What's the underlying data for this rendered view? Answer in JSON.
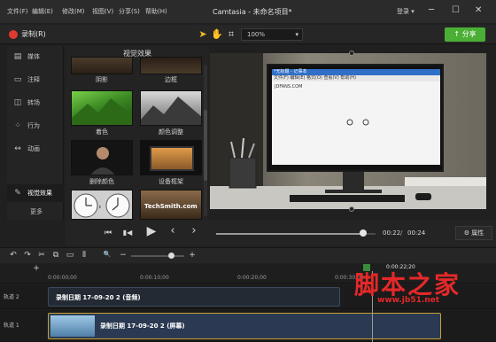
{
  "menubar": {
    "items": [
      "文件(F)",
      "编辑(E)",
      "修改(M)",
      "视图(V)",
      "分享(S)",
      "帮助(H)"
    ],
    "title": "Camtasia - 未命名项目*",
    "login": "登录",
    "login_caret": "▾",
    "minimize": "─",
    "maximize": "☐",
    "close": "✕"
  },
  "toolbar": {
    "record_label": "录制(R)",
    "zoom_value": "100%",
    "zoom_caret": "▾",
    "share_label": "分享",
    "share_icon": "↑"
  },
  "sidebar": {
    "items": [
      {
        "label": "媒体",
        "icon": "▤"
      },
      {
        "label": "注释",
        "icon": "▭"
      },
      {
        "label": "转场",
        "icon": "◫"
      },
      {
        "label": "行为",
        "icon": "⁘"
      },
      {
        "label": "动画",
        "icon": "↔"
      },
      {
        "label": "视觉效果",
        "icon": "✎"
      }
    ],
    "more": "更多",
    "active_index": 5
  },
  "effects": {
    "title": "视觉效果",
    "thumbs": [
      {
        "label": "阴影"
      },
      {
        "label": "边框"
      },
      {
        "label": "着色"
      },
      {
        "label": "颜色调整"
      },
      {
        "label": "删除颜色"
      },
      {
        "label": "设备框架"
      },
      {
        "label": ""
      },
      {
        "label": "TechSmith.com"
      }
    ]
  },
  "playback": {
    "prev_icon": "⏮",
    "step_back_icon": "▮◀",
    "play_icon": "▶",
    "prev_frame_icon": "‹",
    "next_frame_icon": "›",
    "progress_fraction": 0.92,
    "time_current": "00:22",
    "time_separator": "/",
    "time_total": "00:24",
    "properties_label": "属性",
    "gear_icon": "⚙"
  },
  "canvas_screen": {
    "window_title": "*无标题 - 记事本",
    "menu_text": "文件(F) 编辑(E) 格式(O) 查看(V) 帮助(H)",
    "body_text": "JDFANS.COM"
  },
  "timeline_toolbar": {
    "undo": "↶",
    "redo": "↷",
    "cut": "✂",
    "copy": "⧉",
    "paste": "▭",
    "split": "⫴",
    "zoom_icon": "🔍",
    "zoom_minus": "−",
    "zoom_plus": "+",
    "zoom_fraction": 0.75
  },
  "ruler": {
    "labels": [
      "0:00:00;00",
      "0:00:10;00",
      "0:00:20;00",
      "0:00:30;00"
    ],
    "playhead_label": "0:00:22;20",
    "add_track": "+"
  },
  "tracks": [
    {
      "label": "轨道 2",
      "clip_text": "录制日期 17-09-20 2 (音频)"
    },
    {
      "label": "轨道 1",
      "clip_text": "录制日期 17-09-20 2 (屏幕)"
    }
  ],
  "watermark": {
    "text": "脚本之家",
    "url": "www.jb51.net"
  },
  "colors": {
    "accent_green": "#4caf35",
    "record_red": "#e03a30",
    "clip_blue": "#2f4f7a",
    "clip_gold": "#c8a030",
    "watermark_red": "#e62828"
  }
}
